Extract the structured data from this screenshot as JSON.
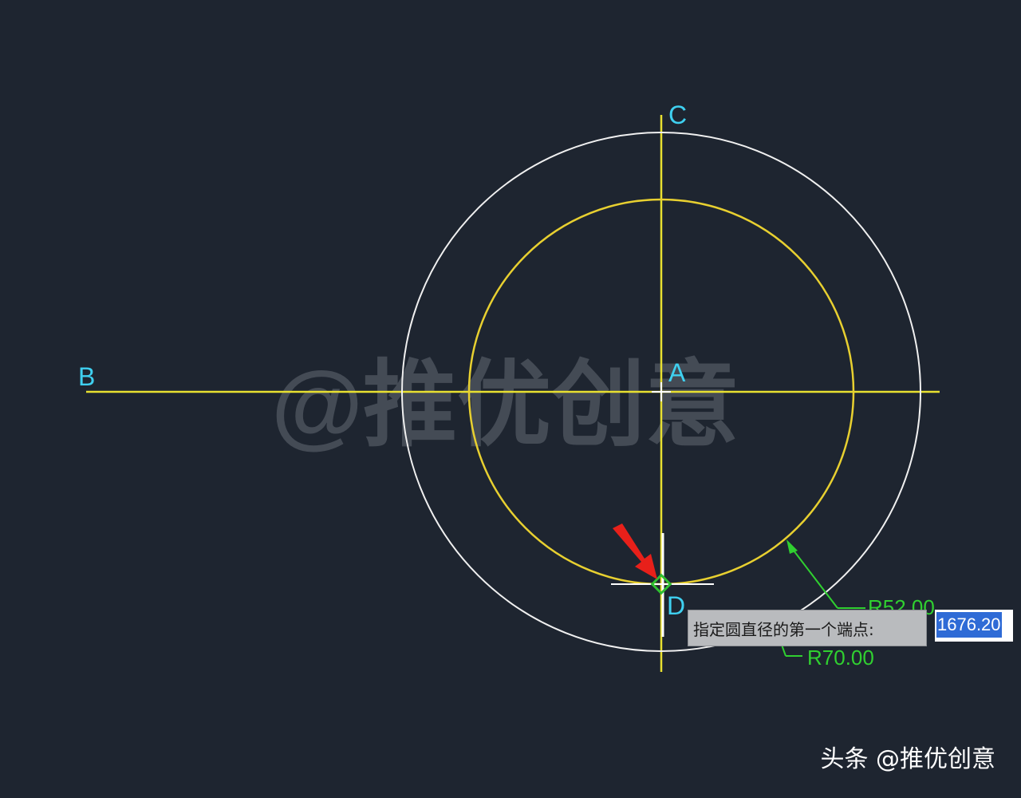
{
  "labels": {
    "point_a": "A",
    "point_b": "B",
    "point_c": "C",
    "point_d": "D"
  },
  "dimensions": {
    "inner_radius": "R52.00",
    "outer_radius": "R70.00"
  },
  "prompt": {
    "text": "指定圆直径的第一个端点:",
    "value": "1676.20"
  },
  "watermark": "@推优创意",
  "footer": {
    "brand": "头条 @推优创意"
  },
  "colors": {
    "background": "#1e2530",
    "construction_lines": "#e8e030",
    "inner_circle": "#e8d030",
    "outer_circle": "#f0f0f0",
    "point_labels": "#3fd0f0",
    "dimension": "#30d030",
    "arrow": "#e8201a",
    "snap_marker": "#30c030"
  },
  "icons": {
    "pointer": "red-arrow-icon",
    "snap": "tangent-snap-icon",
    "cursor": "crosshair-cursor-icon"
  }
}
